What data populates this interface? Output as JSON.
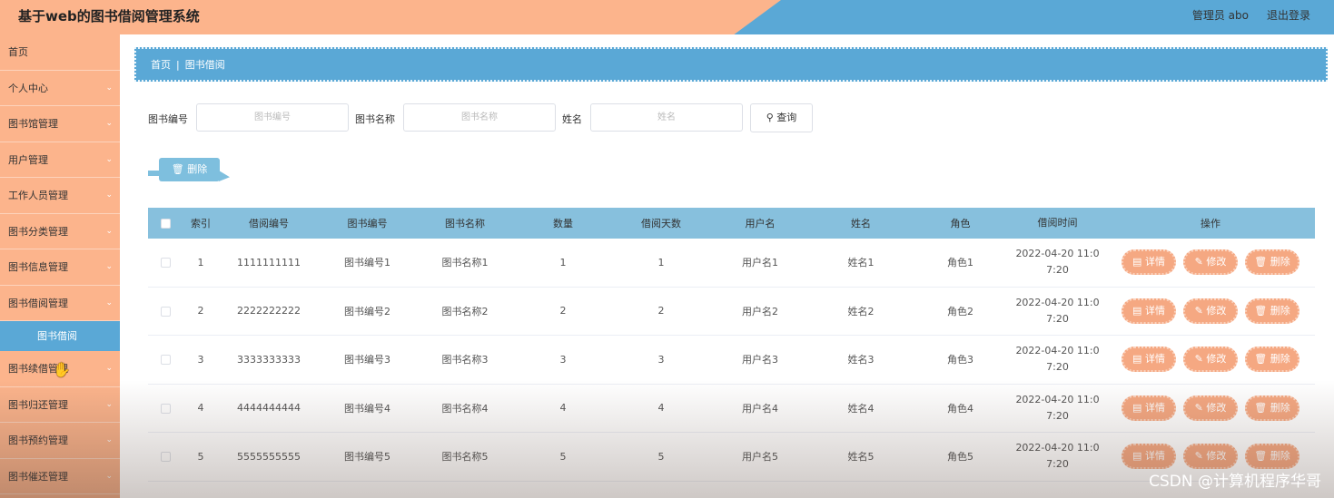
{
  "header": {
    "title": "基于web的图书借阅管理系统",
    "user": "管理员 abo",
    "logout": "退出登录"
  },
  "sidebar": {
    "items": [
      {
        "label": "首页",
        "chevron": false
      },
      {
        "label": "个人中心",
        "chevron": true
      },
      {
        "label": "图书馆管理",
        "chevron": true
      },
      {
        "label": "用户管理",
        "chevron": true
      },
      {
        "label": "工作人员管理",
        "chevron": true
      },
      {
        "label": "图书分类管理",
        "chevron": true
      },
      {
        "label": "图书信息管理",
        "chevron": true
      },
      {
        "label": "图书借阅管理",
        "chevron": true
      },
      {
        "label": "图书借阅",
        "sub": true
      },
      {
        "label": "图书续借管理",
        "chevron": true
      },
      {
        "label": "图书归还管理",
        "chevron": true
      },
      {
        "label": "图书预约管理",
        "chevron": true
      },
      {
        "label": "图书催还管理",
        "chevron": true
      }
    ]
  },
  "breadcrumb": {
    "home": "首页",
    "current": "图书借阅"
  },
  "search": {
    "book_no_label": "图书编号",
    "book_no_placeholder": "图书编号",
    "book_name_label": "图书名称",
    "book_name_placeholder": "图书名称",
    "name_label": "姓名",
    "name_placeholder": "姓名",
    "query_label": "查询"
  },
  "toolbar": {
    "delete_label": "删除"
  },
  "table": {
    "headers": [
      "索引",
      "借阅编号",
      "图书编号",
      "图书名称",
      "数量",
      "借阅天数",
      "用户名",
      "姓名",
      "角色",
      "借阅时间",
      "操作"
    ],
    "rows": [
      {
        "idx": "1",
        "borrow_no": "1111111111",
        "book_no": "图书编号1",
        "book_name": "图书名称1",
        "qty": "1",
        "days": "1",
        "username": "用户名1",
        "name": "姓名1",
        "role": "角色1",
        "time_a": "2022-04-20 11:0",
        "time_b": "7:20"
      },
      {
        "idx": "2",
        "borrow_no": "2222222222",
        "book_no": "图书编号2",
        "book_name": "图书名称2",
        "qty": "2",
        "days": "2",
        "username": "用户名2",
        "name": "姓名2",
        "role": "角色2",
        "time_a": "2022-04-20 11:0",
        "time_b": "7:20"
      },
      {
        "idx": "3",
        "borrow_no": "3333333333",
        "book_no": "图书编号3",
        "book_name": "图书名称3",
        "qty": "3",
        "days": "3",
        "username": "用户名3",
        "name": "姓名3",
        "role": "角色3",
        "time_a": "2022-04-20 11:0",
        "time_b": "7:20"
      },
      {
        "idx": "4",
        "borrow_no": "4444444444",
        "book_no": "图书编号4",
        "book_name": "图书名称4",
        "qty": "4",
        "days": "4",
        "username": "用户名4",
        "name": "姓名4",
        "role": "角色4",
        "time_a": "2022-04-20 11:0",
        "time_b": "7:20"
      },
      {
        "idx": "5",
        "borrow_no": "5555555555",
        "book_no": "图书编号5",
        "book_name": "图书名称5",
        "qty": "5",
        "days": "5",
        "username": "用户名5",
        "name": "姓名5",
        "role": "角色5",
        "time_a": "2022-04-20 11:0",
        "time_b": "7:20"
      }
    ],
    "actions": {
      "detail": "详情",
      "edit": "修改",
      "delete": "删除"
    }
  },
  "watermark": "CSDN @计算机程序华哥",
  "colors": {
    "peach": "#fcb48c",
    "blue": "#5aa8d6",
    "table_header": "#87c0dd",
    "action_button": "#f5a882"
  }
}
